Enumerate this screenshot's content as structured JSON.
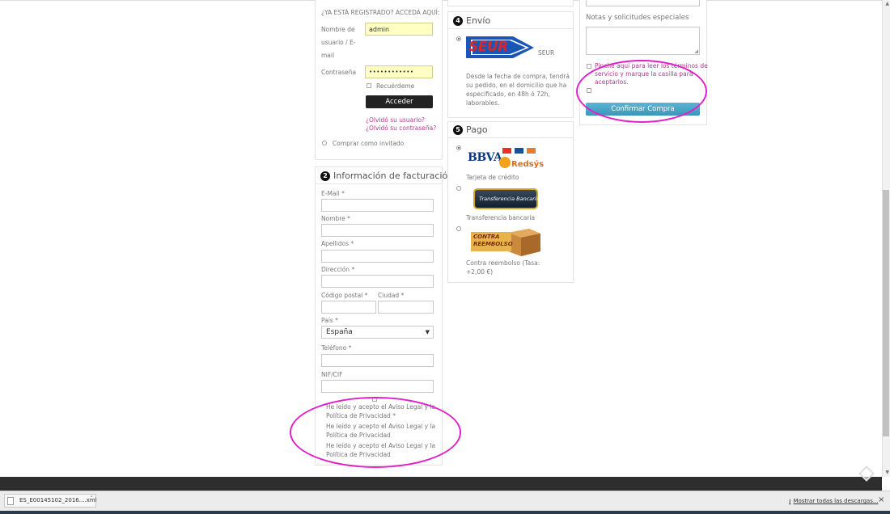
{
  "login": {
    "header": "¿YA ESTÁ REGISTRADO? ACCEDA AQUÍ:",
    "user_label_1": "Nombre de",
    "user_label_2": "usuario / E-",
    "user_label_3": "mail",
    "user_value": "admin",
    "password_label": "Contraseña",
    "password_value": "••••••••••••",
    "remember_label": "Recuérdeme",
    "login_button": "Acceder",
    "forgot_user": "¿Olvidó su usuario?",
    "forgot_password": "¿Olvidó su contraseña?",
    "guest_label": "Comprar como invitado"
  },
  "billing": {
    "step": "2",
    "title": "Información de facturación",
    "email_label": "E-Mail *",
    "name_label": "Nombre *",
    "surname_label": "Apellidos *",
    "address_label": "Dirección *",
    "postal_label": "Código postal *",
    "city_label": "Ciudad *",
    "country_label": "País *",
    "country_value": "España",
    "phone_label": "Teléfono *",
    "nif_label": "NIF/CIF",
    "legal_1a": "He leído y acepto el Aviso Legal y la",
    "legal_1b": "Política de Privacidad *",
    "legal_2a": "He leído y acepto el Aviso Legal y la",
    "legal_2b": "Política de Privacidad",
    "legal_3a": "He leído y acepto el Aviso Legal y la",
    "legal_3b": "Política de Privacidad"
  },
  "shipping": {
    "step": "4",
    "title": "Envío",
    "logo_text": "SEUR",
    "carrier_name": "SEUR",
    "desc_1": "Desde la fecha de compra, tendrá",
    "desc_2": "su pedido, en el domicilio que ha",
    "desc_3": "especificado, en 48h ó 72h,",
    "desc_4": "laborables."
  },
  "payment": {
    "step": "5",
    "title": "Pago",
    "bbva_text": "BBVA",
    "redsys_text": "Redsýs",
    "card_label": "Tarjeta de crédito",
    "transfer_logo": "Transferencia Bancaria",
    "transfer_label": "Transferencia bancaria",
    "cod_logo_1": "CONTRA",
    "cod_logo_2": "REEMBOLSO",
    "cod_label_1": "Contra reembolso  (Tasa:",
    "cod_label_2": "+2,00 €)"
  },
  "confirm": {
    "notes_label": "Notas y solicitudes especiales",
    "tos_1": "Pinche aquí para leer los términos de",
    "tos_2": "servicio y marque la casilla para",
    "tos_3": "aceptarlos.",
    "confirm_button": "Confirmar Compra"
  },
  "downloads": {
    "file_name": "ES_E00145102_2016....xml",
    "show_all": "Mostrar todas las descargas...",
    "close": "×"
  },
  "colors": {
    "highlight": "#e020c8",
    "link": "#b4398e",
    "confirm_button": "#3a97bb",
    "seur_blue": "#1a56b5",
    "seur_red": "#d8262d"
  }
}
